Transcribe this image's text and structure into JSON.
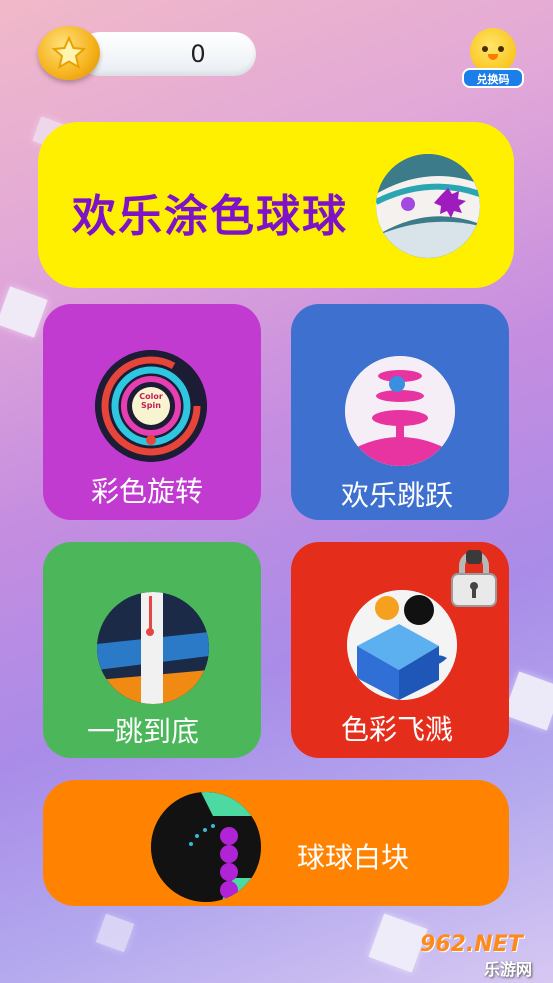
{
  "header": {
    "coin_count": "0",
    "redeem_label": "兑换码"
  },
  "games": {
    "featured": {
      "label": "欢乐涂色球球"
    },
    "color_spin": {
      "label": "彩色旋转",
      "thumb_text_1": "Color",
      "thumb_text_2": "Spin"
    },
    "happy_jump": {
      "label": "欢乐跳跃"
    },
    "jump_down": {
      "label": "一跳到底"
    },
    "color_splash": {
      "label": "色彩飞溅",
      "locked": true
    },
    "ball_white": {
      "label": "球球白块"
    }
  },
  "watermark": {
    "top": "962.NET",
    "bottom": "乐游网"
  },
  "colors": {
    "featured_bg": "#fff000",
    "featured_text": "#7d12c8",
    "spin_bg": "#c13bd0",
    "jump_bg": "#3e71cf",
    "drop_bg": "#4bb75a",
    "splash_bg": "#e52d1b",
    "white_bg": "#ff8200"
  }
}
